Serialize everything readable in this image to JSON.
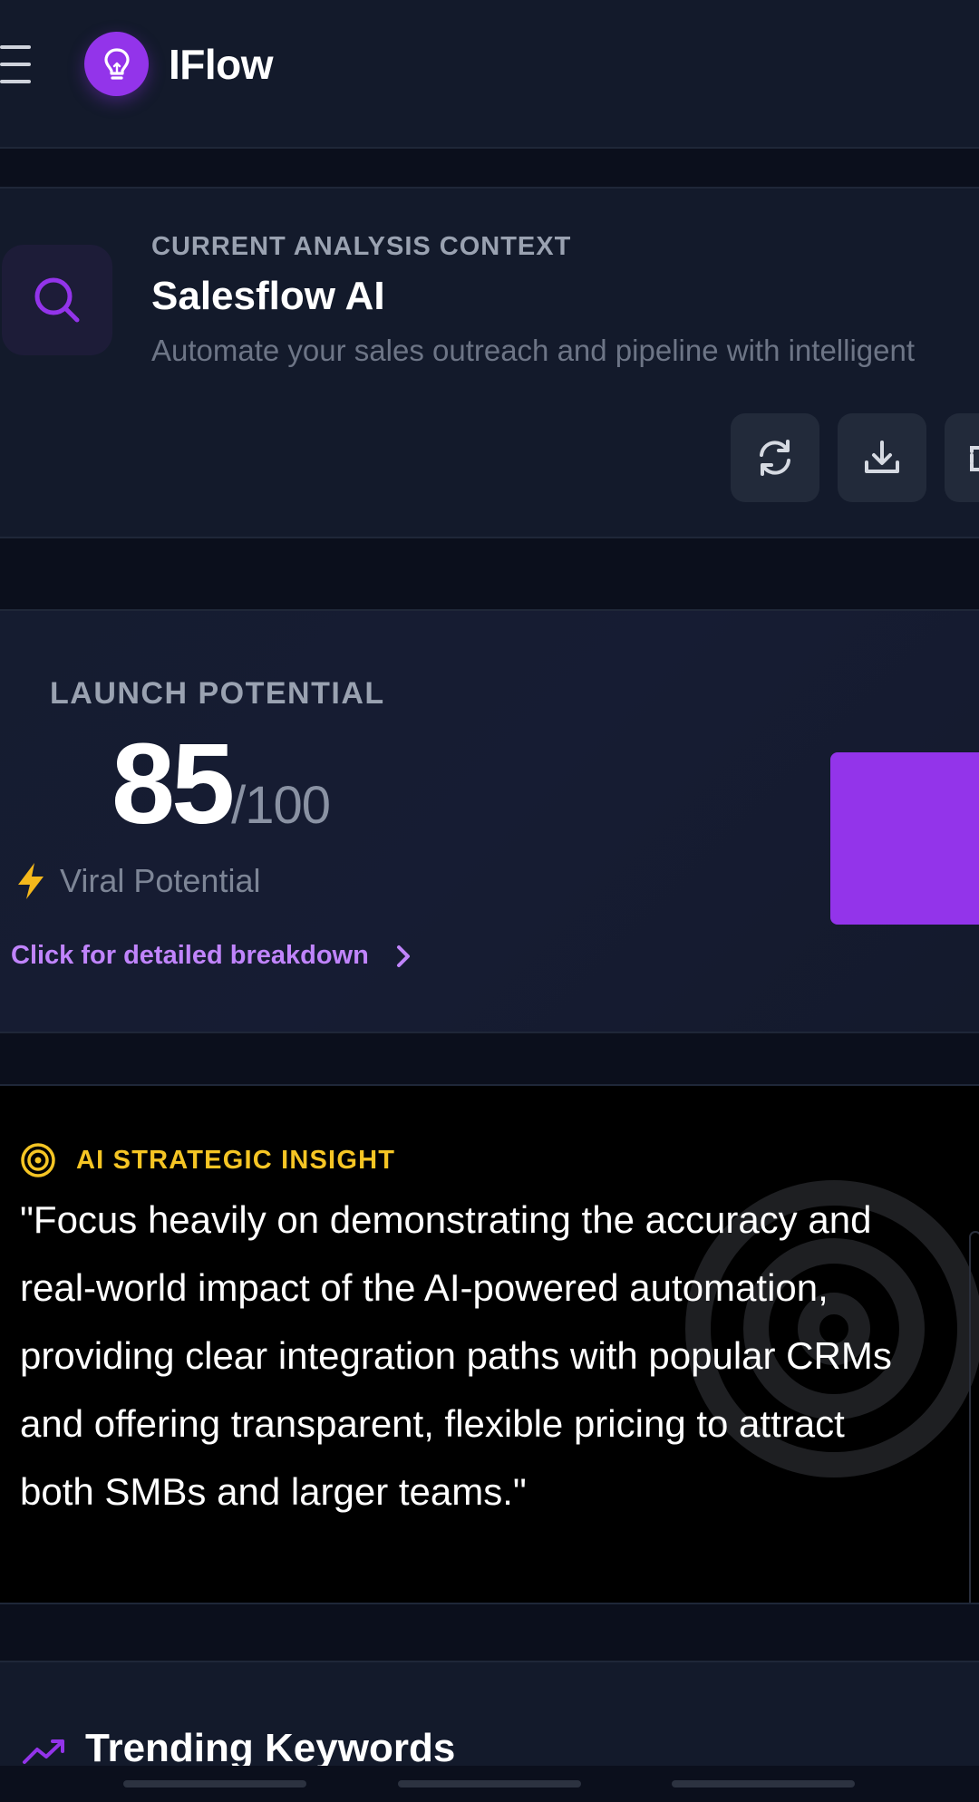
{
  "header": {
    "app_name": "IFlow",
    "menu_icon": "hamburger-menu-icon",
    "logo_icon": "lightbulb-icon",
    "brand_color": "#9334EA"
  },
  "context": {
    "label": "CURRENT ANALYSIS CONTEXT",
    "title": "Salesflow AI",
    "description": "Automate your sales outreach and pipeline with intelligent",
    "icon": "search-icon",
    "actions": [
      {
        "icon": "refresh-icon"
      },
      {
        "icon": "download-icon"
      },
      {
        "icon": "print-icon"
      }
    ]
  },
  "launch": {
    "label": "LAUNCH POTENTIAL",
    "score": "85",
    "score_max": "/100",
    "tag_icon": "lightning-icon",
    "tag": "Viral Potential",
    "link": "Click for detailed breakdown",
    "accent_color": "#9334EA"
  },
  "insight": {
    "label": "AI STRATEGIC INSIGHT",
    "icon": "target-icon",
    "label_color": "#F5C524",
    "quote_lines": [
      "\"Focus heavily on demonstrating the accuracy and",
      "real-world impact of the AI-powered automation,",
      "providing clear integration paths with popular CRMs",
      "and offering transparent, flexible pricing to attract",
      "both SMBs and larger teams.\""
    ]
  },
  "trending": {
    "title": "Trending Keywords",
    "icon": "trending-up-icon"
  }
}
